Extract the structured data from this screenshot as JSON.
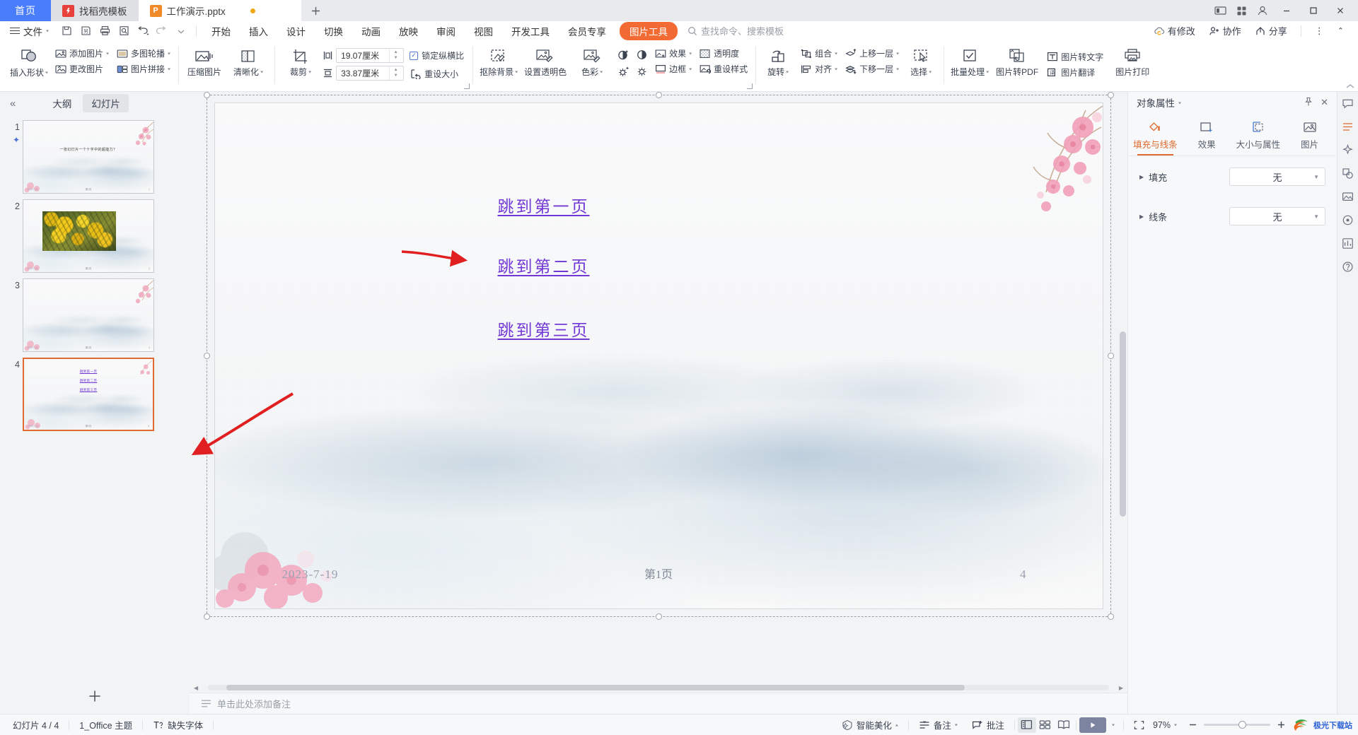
{
  "window": {
    "tabs": [
      {
        "label": "首页",
        "icon": "home-tab",
        "type": "home"
      },
      {
        "label": "找稻壳模板",
        "icon": "docer-icon",
        "type": "docer"
      },
      {
        "label": "工作演示.pptx",
        "icon": "ppt-icon",
        "type": "file",
        "modified": true
      }
    ],
    "new_tab_label": "+",
    "controls": {
      "minimize": "—",
      "maximize": "▢",
      "close": "✕"
    }
  },
  "menubar": {
    "file_label": "文件",
    "quick_access": [
      "save-icon",
      "save-as-icon",
      "print-icon",
      "print-preview-icon",
      "undo-icon",
      "redo-icon",
      "customize-icon"
    ],
    "items": [
      "开始",
      "插入",
      "设计",
      "切换",
      "动画",
      "放映",
      "审阅",
      "视图",
      "开发工具",
      "会员专享"
    ],
    "active_pill": "图片工具",
    "search_placeholder": "查找命令、搜索模板",
    "right_items": [
      {
        "label": "有修改",
        "icon": "cloud-sync-icon"
      },
      {
        "label": "协作",
        "icon": "collaborate-icon"
      },
      {
        "label": "分享",
        "icon": "share-icon"
      }
    ],
    "more_icon": "⋮",
    "collapse_icon": "⌃"
  },
  "ribbon": {
    "groups": [
      {
        "name": "insert-picture",
        "big": [
          {
            "label": "插入形状",
            "icon": "shapes-icon",
            "dropdown": true
          }
        ],
        "pairs": [
          [
            {
              "label": "添加图片",
              "icon": "add-picture-icon",
              "dropdown": true
            },
            {
              "label": "更改图片",
              "icon": "change-picture-icon",
              "dropdown": false
            }
          ],
          [
            {
              "label": "多图轮播",
              "icon": "carousel-icon",
              "dropdown": true
            },
            {
              "label": "图片拼接",
              "icon": "collage-icon",
              "dropdown": true
            }
          ]
        ]
      },
      {
        "name": "picture-adjust",
        "verticals": [
          {
            "label": "压缩图片",
            "icon": "compress-icon",
            "dropdown": false
          },
          {
            "label": "清晰化",
            "icon": "sharpen-icon",
            "dropdown": true
          }
        ]
      },
      {
        "name": "size-crop",
        "verticals": [
          {
            "label": "裁剪",
            "icon": "crop-icon",
            "dropdown": true
          }
        ],
        "size": {
          "height_icon": "height-icon",
          "width_icon": "width-icon",
          "height_value": "19.07厘米",
          "width_value": "33.87厘米",
          "lock_label": "锁定纵横比",
          "lock_checked": true,
          "reset_label": "重设大小",
          "reset_icon": "reset-size-icon"
        }
      },
      {
        "name": "picture-effects",
        "verticals": [
          {
            "label": "抠除背景",
            "icon": "remove-bg-icon",
            "dropdown": true
          },
          {
            "label": "设置透明色",
            "icon": "set-transparent-icon",
            "dropdown": false
          },
          {
            "label": "色彩",
            "icon": "color-icon",
            "dropdown": true
          }
        ],
        "tiny_icons": [
          "contrast-up-icon",
          "contrast-down-icon",
          "brightness-up-icon",
          "brightness-down-icon"
        ],
        "pairs": [
          [
            {
              "label": "效果",
              "icon": "effects-icon",
              "dropdown": true
            },
            {
              "label": "边框",
              "icon": "border-icon",
              "dropdown": true
            }
          ],
          [
            {
              "label": "透明度",
              "icon": "transparency-icon",
              "dropdown": false
            },
            {
              "label": "重设样式",
              "icon": "reset-style-icon",
              "dropdown": false
            }
          ]
        ]
      },
      {
        "name": "arrange",
        "verticals": [
          {
            "label": "旋转",
            "icon": "rotate-icon",
            "dropdown": true
          }
        ],
        "pairs": [
          [
            {
              "label": "组合",
              "icon": "group-icon",
              "dropdown": true
            },
            {
              "label": "对齐",
              "icon": "align-icon",
              "dropdown": true
            }
          ],
          [
            {
              "label": "上移一层",
              "icon": "bring-forward-icon",
              "dropdown": true
            },
            {
              "label": "下移一层",
              "icon": "send-backward-icon",
              "dropdown": true
            }
          ]
        ],
        "select": {
          "label": "选择",
          "icon": "select-objects-icon",
          "dropdown": true
        }
      },
      {
        "name": "picture-tools-convert",
        "verticals": [
          {
            "label": "批量处理",
            "icon": "batch-icon",
            "dropdown": true
          },
          {
            "label": "图片转PDF",
            "icon": "pic-to-pdf-icon",
            "dropdown": false
          }
        ],
        "pairs": [
          [
            {
              "label": "图片转文字",
              "icon": "pic-to-text-icon",
              "dropdown": false
            },
            {
              "label": "图片翻译",
              "icon": "pic-translate-icon",
              "dropdown": false
            }
          ]
        ],
        "last": {
          "label": "图片打印",
          "icon": "pic-print-icon",
          "dropdown": false
        }
      }
    ]
  },
  "slide_panel": {
    "collapse_icon": "«",
    "tabs": [
      {
        "label": "大纲",
        "active": false
      },
      {
        "label": "幻灯片",
        "active": true
      }
    ],
    "slides": [
      {
        "number": "1",
        "starred": true,
        "selected": false,
        "kind": "title",
        "title": "一张幻灯片一个十字中的超能力？"
      },
      {
        "number": "2",
        "starred": false,
        "selected": false,
        "kind": "image"
      },
      {
        "number": "3",
        "starred": false,
        "selected": false,
        "kind": "blank"
      },
      {
        "number": "4",
        "starred": false,
        "selected": true,
        "kind": "links"
      }
    ],
    "add_slide_icon": "+"
  },
  "slide": {
    "links": [
      "跳到第一页",
      "跳到第二页",
      "跳到第三页"
    ],
    "date": "2023-7-19",
    "page_text": "第1页",
    "slide_number": "4",
    "rotate_handle_icon": "rotate-handle-icon"
  },
  "notes": {
    "placeholder": "单击此处添加备注",
    "icon": "notes-icon"
  },
  "right_panel": {
    "title": "对象属性",
    "pin_icon": "pin-icon",
    "close_icon": "✕",
    "tabs": [
      {
        "label": "填充与线条",
        "icon": "fill-line-icon",
        "active": true
      },
      {
        "label": "效果",
        "icon": "effects-panel-icon",
        "active": false
      },
      {
        "label": "大小与属性",
        "icon": "size-props-icon",
        "active": false
      },
      {
        "label": "图片",
        "icon": "picture-panel-icon",
        "active": false
      }
    ],
    "rows": [
      {
        "label": "填充",
        "value": "无"
      },
      {
        "label": "线条",
        "value": "无"
      }
    ]
  },
  "rail": {
    "icons": [
      "help-chat-icon",
      "format-brush-icon",
      "magic-icon",
      "shapes-rail-icon",
      "picture-rail-icon",
      "location-icon",
      "chart-rail-icon",
      "question-icon"
    ]
  },
  "status": {
    "left": [
      {
        "label": "幻灯片 4 / 4",
        "icon": ""
      },
      {
        "label": "1_Office 主题",
        "icon": ""
      },
      {
        "label": "缺失字体",
        "icon": "font-missing-icon"
      }
    ],
    "right": [
      {
        "label": "智能美化",
        "icon": "beautify-icon",
        "dropdown": true
      },
      {
        "label": "备注",
        "icon": "notes-status-icon",
        "dropdown": true
      },
      {
        "label": "批注",
        "icon": "comment-icon",
        "dropdown": false
      }
    ],
    "views": [
      "normal-view-icon",
      "sorter-view-icon",
      "reading-view-icon"
    ],
    "active_view": "normal-view-icon",
    "play_label": "▶",
    "fit_icon": "fit-screen-icon",
    "zoom_label": "97%",
    "zoom_minus": "—",
    "zoom_plus": "+",
    "watermark": "极光下载站"
  },
  "colors": {
    "accent_blue": "#4a7dfc",
    "accent_orange": "#f26b34",
    "link_purple": "#7238d6",
    "selection_orange": "#e06a2f",
    "arrow_red": "#e02020"
  }
}
